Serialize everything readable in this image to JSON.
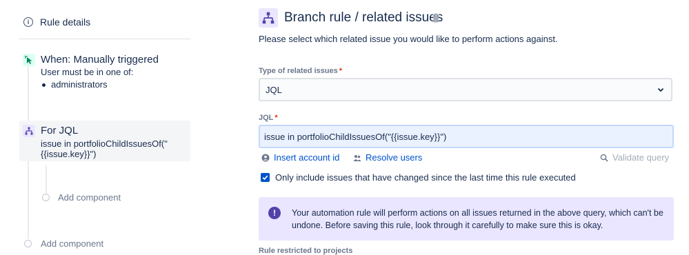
{
  "sidebar": {
    "rule_details": "Rule details",
    "trigger": {
      "title": "When: Manually triggered",
      "subtitle": "User must be in one of:",
      "group": "administrators"
    },
    "branch": {
      "title": "For JQL",
      "detail": "issue in portfolioChildIssuesOf(\"{{issue.key}}\")"
    },
    "add_component_nested": "Add component",
    "add_component": "Add component"
  },
  "main": {
    "title": "Branch rule / related issues",
    "description": "Please select which related issue you would like to perform actions against.",
    "type_label": "Type of related issues",
    "type_value": "JQL",
    "jql_label": "JQL",
    "jql_value": "issue in portfolioChildIssuesOf(\"{{issue.key}}\")",
    "insert_account_id": "Insert account id",
    "resolve_users": "Resolve users",
    "validate_query": "Validate query",
    "checkbox_label": "Only include issues that have changed since the last time this rule executed",
    "checkbox_checked": true,
    "warning": "Your automation rule will perform actions on all issues returned in the above query, which can't be undone. Before saving this rule, look through it carefully to make sure this is okay.",
    "restricted_label": "Rule restricted to projects",
    "required_mark": "*"
  },
  "colors": {
    "accent": "#0052cc",
    "branch_bg": "#eae6ff",
    "trigger_bg": "#dcfff1",
    "warning_icon": "#5243aa"
  },
  "icons": [
    "info-icon",
    "cursor-click-icon",
    "branch-icon",
    "trash-icon",
    "chevron-down-icon",
    "person-icon",
    "users-icon",
    "search-icon",
    "check-icon",
    "exclamation-icon"
  ]
}
